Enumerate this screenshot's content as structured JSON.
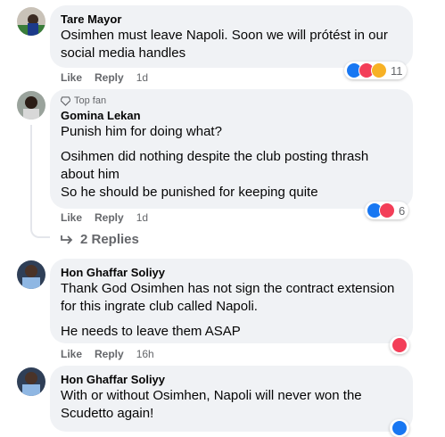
{
  "comments": [
    {
      "author": "Tare Mayor",
      "lines": [
        "Osimhen must leave Napoli. Soon we will prótést in our social media handles"
      ],
      "like": "Like",
      "reply": "Reply",
      "time": "1d",
      "reaction_count": "11"
    },
    {
      "badge": "Top fan",
      "author": "Gomina Lekan",
      "paras": [
        "Punish him for doing what?",
        "Osihmen did nothing despite the club posting thrash about him\nSo he should be punished for keeping quite"
      ],
      "like": "Like",
      "reply": "Reply",
      "time": "1d",
      "reaction_count": "6"
    },
    {
      "author": "Hon Ghaffar Soliyy",
      "paras": [
        "Thank God Osimhen has not sign the contract extension for this ingrate club called Napoli.",
        "He needs to leave them ASAP"
      ],
      "like": "Like",
      "reply": "Reply",
      "time": "16h"
    },
    {
      "author": "Hon Ghaffar Soliyy",
      "paras": [
        "With or without Osimhen, Napoli will never won the Scudetto again!"
      ]
    }
  ],
  "replies_link": "2 Replies",
  "colors": {
    "like": "#1877f2",
    "love": "#f33e58",
    "haha": "#f7b125",
    "bubble": "#f0f2f5"
  },
  "icons": [
    "like-reaction-icon",
    "love-reaction-icon",
    "haha-reaction-icon",
    "reply-arrow-icon",
    "top-fan-badge-icon"
  ]
}
